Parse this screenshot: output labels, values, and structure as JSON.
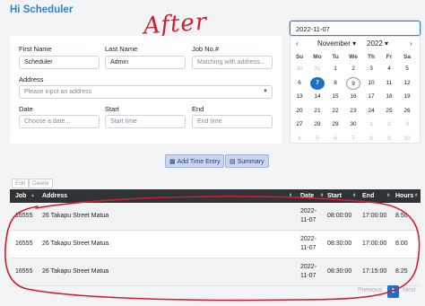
{
  "app": {
    "title": "Hi Scheduler",
    "annotation": "After"
  },
  "form": {
    "first_name_label": "First Name",
    "first_name_value": "Scheduler",
    "last_name_label": "Last Name",
    "last_name_value": "Admin",
    "job_label": "Job No.#",
    "job_placeholder": "Matching with address...",
    "address_label": "Address",
    "address_placeholder": "Please input an address",
    "date_label": "Date",
    "date_placeholder": "Choose a date...",
    "start_label": "Start",
    "start_placeholder": "Start time",
    "end_label": "End",
    "end_placeholder": "End time"
  },
  "date_picker": {
    "value": "2022-11-07",
    "month": "November",
    "year": "2022",
    "weekdays": [
      "Su",
      "Mo",
      "Tu",
      "We",
      "Th",
      "Fr",
      "Sa"
    ],
    "weeks": [
      [
        "30",
        "31",
        "1",
        "2",
        "3",
        "4",
        "5"
      ],
      [
        "6",
        "7",
        "8",
        "9",
        "10",
        "11",
        "12"
      ],
      [
        "13",
        "14",
        "15",
        "16",
        "17",
        "18",
        "19"
      ],
      [
        "20",
        "21",
        "22",
        "23",
        "24",
        "25",
        "26"
      ],
      [
        "27",
        "28",
        "29",
        "30",
        "1",
        "2",
        "3"
      ],
      [
        "4",
        "5",
        "6",
        "7",
        "8",
        "9",
        "10"
      ]
    ]
  },
  "actions": {
    "add_time_entry": "Add Time Entry",
    "summary": "Summary"
  },
  "table_tools": {
    "edit": "Edit",
    "delete": "Delete"
  },
  "table": {
    "columns": [
      "Job",
      "Address",
      "Date",
      "Start",
      "End",
      "Hours"
    ],
    "rows": [
      {
        "job": "16555",
        "address": "26 Takapu Street Matua",
        "date_line1": "2022-",
        "date_line2": "11-07",
        "start": "08:00:00",
        "end": "17:00:00",
        "hours": "8.50"
      },
      {
        "job": "16555",
        "address": "26 Takapu Street Matua",
        "date_line1": "2022-",
        "date_line2": "11-07",
        "start": "08:30:00",
        "end": "17:00:00",
        "hours": "8.00"
      },
      {
        "job": "16555",
        "address": "26 Takapu Street Matua",
        "date_line1": "2022-",
        "date_line2": "11-07",
        "start": "08:30:00",
        "end": "17:15:00",
        "hours": "8.25"
      }
    ]
  },
  "pagination": {
    "previous": "Previous",
    "current_page": "1",
    "next": "Next"
  },
  "colors": {
    "accent": "#1f6fc6",
    "annotation_red": "#d41c2c",
    "header_dark": "#2f3336"
  }
}
